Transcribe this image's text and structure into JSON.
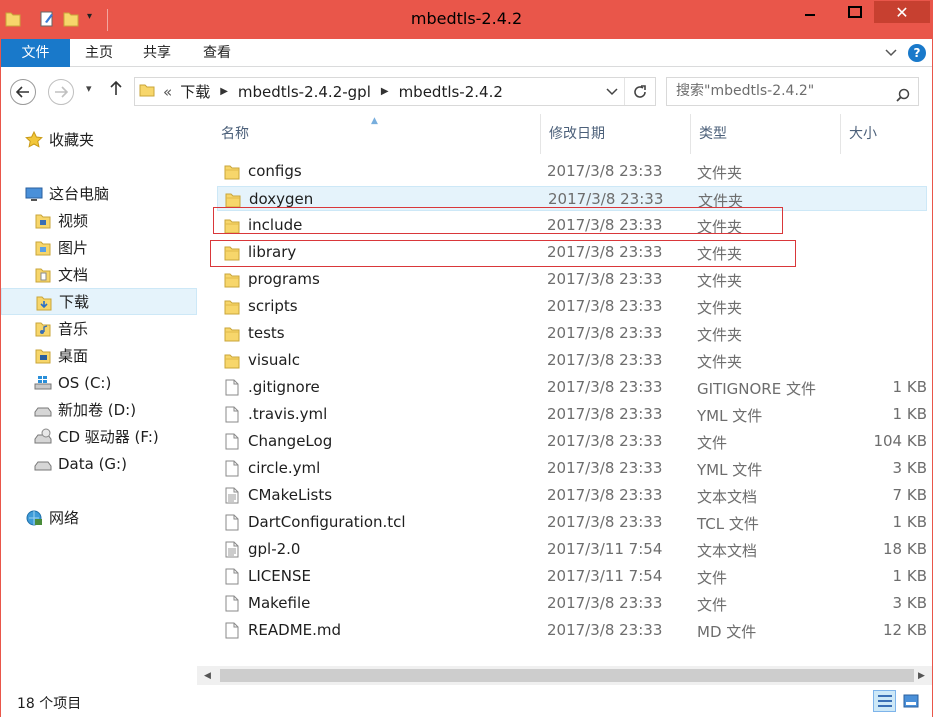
{
  "window": {
    "title": "mbedtls-2.4.2",
    "accent_color": "#e9564a",
    "close_label": "✕"
  },
  "ribbon": {
    "tabs": [
      "文件",
      "主页",
      "共享",
      "查看"
    ],
    "file_tab_color": "#1979ca",
    "help_label": "?"
  },
  "address": {
    "overflow": "«",
    "crumbs": [
      "下载",
      "mbedtls-2.4.2-gpl",
      "mbedtls-2.4.2"
    ],
    "search_placeholder": "搜索\"mbedtls-2.4.2\""
  },
  "nav_pane": {
    "items": [
      {
        "label": "收藏夹",
        "icon": "star-icon",
        "child": false
      },
      {
        "label": "这台电脑",
        "icon": "computer-icon",
        "child": false
      },
      {
        "label": "视频",
        "icon": "video-folder-icon",
        "child": true
      },
      {
        "label": "图片",
        "icon": "pictures-folder-icon",
        "child": true
      },
      {
        "label": "文档",
        "icon": "documents-folder-icon",
        "child": true
      },
      {
        "label": "下载",
        "icon": "downloads-folder-icon",
        "child": true,
        "selected": true
      },
      {
        "label": "音乐",
        "icon": "music-folder-icon",
        "child": true
      },
      {
        "label": "桌面",
        "icon": "desktop-folder-icon",
        "child": true
      },
      {
        "label": "OS (C:)",
        "icon": "windows-drive-icon",
        "child": true
      },
      {
        "label": "新加卷 (D:)",
        "icon": "drive-icon",
        "child": true
      },
      {
        "label": "CD 驱动器 (F:)",
        "icon": "cd-drive-icon",
        "child": true
      },
      {
        "label": "Data (G:)",
        "icon": "drive-icon",
        "child": true
      },
      {
        "label": "网络",
        "icon": "network-icon",
        "child": false
      }
    ]
  },
  "columns": {
    "name": "名称",
    "date": "修改日期",
    "type": "类型",
    "size": "大小"
  },
  "files": [
    {
      "name": "configs",
      "date": "2017/3/8 23:33",
      "type": "文件夹",
      "size": "",
      "kind": "folder"
    },
    {
      "name": "doxygen",
      "date": "2017/3/8 23:33",
      "type": "文件夹",
      "size": "",
      "kind": "folder",
      "hover": true
    },
    {
      "name": "include",
      "date": "2017/3/8 23:33",
      "type": "文件夹",
      "size": "",
      "kind": "folder"
    },
    {
      "name": "library",
      "date": "2017/3/8 23:33",
      "type": "文件夹",
      "size": "",
      "kind": "folder"
    },
    {
      "name": "programs",
      "date": "2017/3/8 23:33",
      "type": "文件夹",
      "size": "",
      "kind": "folder"
    },
    {
      "name": "scripts",
      "date": "2017/3/8 23:33",
      "type": "文件夹",
      "size": "",
      "kind": "folder"
    },
    {
      "name": "tests",
      "date": "2017/3/8 23:33",
      "type": "文件夹",
      "size": "",
      "kind": "folder"
    },
    {
      "name": "visualc",
      "date": "2017/3/8 23:33",
      "type": "文件夹",
      "size": "",
      "kind": "folder"
    },
    {
      "name": ".gitignore",
      "date": "2017/3/8 23:33",
      "type": "GITIGNORE 文件",
      "size": "1 KB",
      "kind": "file"
    },
    {
      "name": ".travis.yml",
      "date": "2017/3/8 23:33",
      "type": "YML 文件",
      "size": "1 KB",
      "kind": "file"
    },
    {
      "name": "ChangeLog",
      "date": "2017/3/8 23:33",
      "type": "文件",
      "size": "104 KB",
      "kind": "file"
    },
    {
      "name": "circle.yml",
      "date": "2017/3/8 23:33",
      "type": "YML 文件",
      "size": "3 KB",
      "kind": "file"
    },
    {
      "name": "CMakeLists",
      "date": "2017/3/8 23:33",
      "type": "文本文档",
      "size": "7 KB",
      "kind": "text"
    },
    {
      "name": "DartConfiguration.tcl",
      "date": "2017/3/8 23:33",
      "type": "TCL 文件",
      "size": "1 KB",
      "kind": "file"
    },
    {
      "name": "gpl-2.0",
      "date": "2017/3/11 7:54",
      "type": "文本文档",
      "size": "18 KB",
      "kind": "text"
    },
    {
      "name": "LICENSE",
      "date": "2017/3/11 7:54",
      "type": "文件",
      "size": "1 KB",
      "kind": "file"
    },
    {
      "name": "Makefile",
      "date": "2017/3/8 23:33",
      "type": "文件",
      "size": "3 KB",
      "kind": "file"
    },
    {
      "name": "README.md",
      "date": "2017/3/8 23:33",
      "type": "MD 文件",
      "size": "12 KB",
      "kind": "file"
    }
  ],
  "status": {
    "item_count": "18 个项目"
  }
}
